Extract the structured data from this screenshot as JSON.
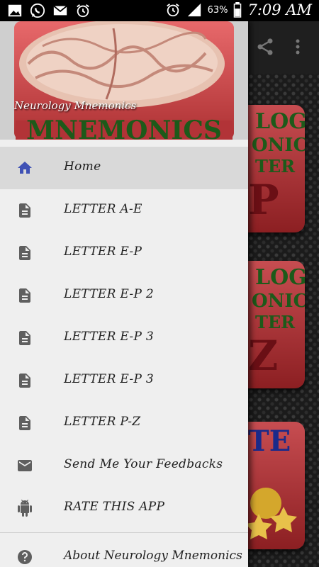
{
  "status_bar": {
    "battery_percent": "63%",
    "time": "7:09 AM",
    "icons": [
      "gallery-icon",
      "whatsapp-icon",
      "email-icon",
      "alarm-icon",
      "alarm-icon",
      "signal-icon",
      "battery-icon"
    ]
  },
  "drawer": {
    "header_title": "Neurology Mnemonics",
    "header_image_text": "MNEMONICS",
    "items": [
      {
        "label": "Home",
        "icon": "home-icon",
        "active": true
      },
      {
        "label": "LETTER A-E",
        "icon": "document-icon"
      },
      {
        "label": "LETTER E-P",
        "icon": "document-icon"
      },
      {
        "label": "LETTER E-P 2",
        "icon": "document-icon"
      },
      {
        "label": "LETTER E-P 3",
        "icon": "document-icon"
      },
      {
        "label": "LETTER E-P 3",
        "icon": "document-icon"
      },
      {
        "label": "LETTER P-Z",
        "icon": "document-icon"
      },
      {
        "label": "Send Me Your Feedbacks",
        "icon": "mail-icon"
      },
      {
        "label": "RATE THIS APP",
        "icon": "android-icon"
      }
    ],
    "about": {
      "label": "About Neurology Mnemonics",
      "icon": "help-icon"
    }
  },
  "background": {
    "tiles": [
      {
        "line1": "LOGY",
        "line2": "ONICS",
        "line3": "TER",
        "letter": "P"
      },
      {
        "line1": "LOGY",
        "line2": "ONICS",
        "line3": "TER",
        "letter": "Z"
      },
      {
        "line1": "TE"
      }
    ]
  },
  "colors": {
    "accent": "#3f51b5",
    "drawer_bg": "#efefef",
    "active_bg": "#d9d9d9"
  }
}
